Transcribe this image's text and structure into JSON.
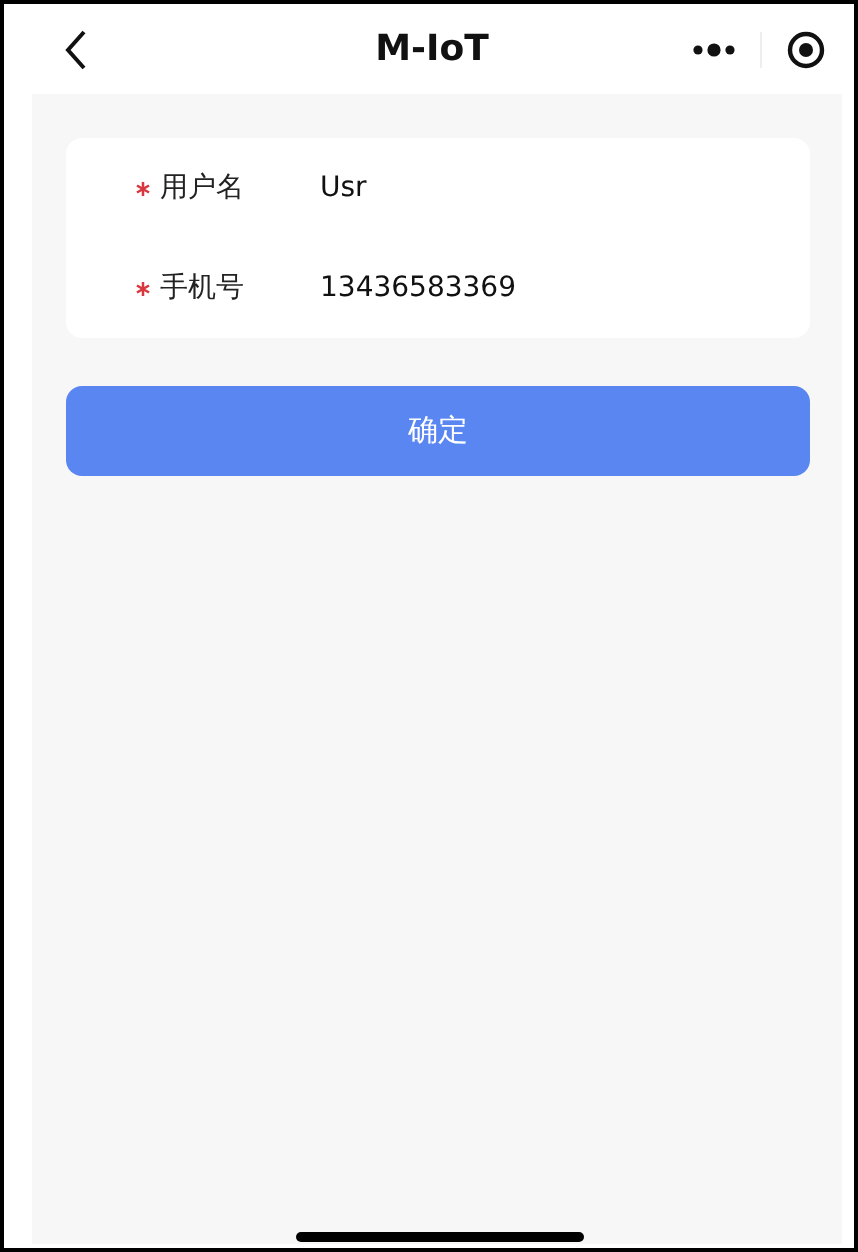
{
  "header": {
    "title": "M-IoT"
  },
  "form": {
    "fields": [
      {
        "label": "用户名",
        "value": "Usr",
        "required": true
      },
      {
        "label": "手机号",
        "value": "13436583369",
        "required": true
      }
    ]
  },
  "buttons": [
    {
      "label": "确定"
    }
  ]
}
